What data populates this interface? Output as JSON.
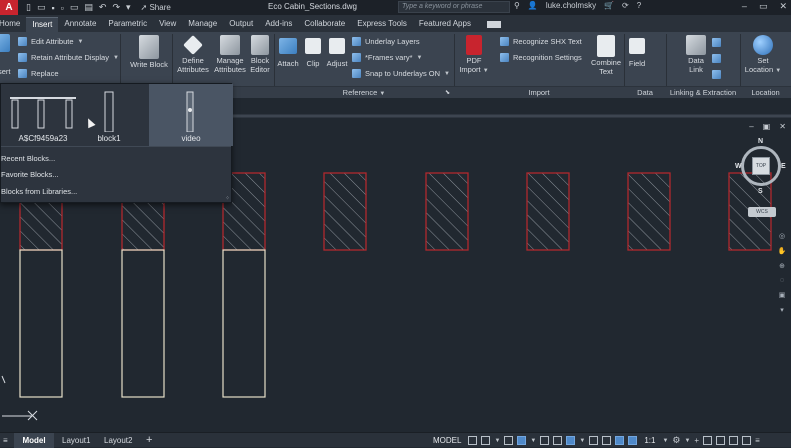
{
  "titlebar": {
    "logo": "A",
    "share_label": "Share",
    "document_title": "Eco Cabin_Sections.dwg",
    "search_placeholder": "Type a keyword or phrase",
    "user_name": "luke.cholmsky"
  },
  "tabs": [
    "Home",
    "Insert",
    "Annotate",
    "Parametric",
    "View",
    "Manage",
    "Output",
    "Add-ins",
    "Collaborate",
    "Express Tools",
    "Featured Apps"
  ],
  "active_tab": "Insert",
  "ribbon": {
    "block_panel": {
      "insert_label": "sert",
      "edit_attribute": "Edit Attribute",
      "retain_attribute_display": "Retain Attribute Display",
      "replace": "Replace"
    },
    "write_block": "Write Block",
    "define_attributes": [
      "Define",
      "Attributes"
    ],
    "manage_attributes": [
      "Manage",
      "Attributes"
    ],
    "block_editor": [
      "Block",
      "Editor"
    ],
    "attach": "Attach",
    "clip": "Clip",
    "adjust": "Adjust",
    "underlay_layers": "Underlay Layers",
    "frames_vary": "*Frames vary*",
    "snap_to_underlays": "Snap to Underlays ON",
    "reference_label": "Reference",
    "pdf_import": [
      "PDF",
      "Import"
    ],
    "recognize_shx": "Recognize SHX Text",
    "recognition_settings": "Recognition Settings",
    "combine_text": [
      "Combine",
      "Text"
    ],
    "import_label": "Import",
    "field": "Field",
    "data_label": "Data",
    "data_link": [
      "Data",
      "Link"
    ],
    "linking_label": "Linking & Extraction",
    "set_location": [
      "Set",
      "Location"
    ],
    "location_label": "Location"
  },
  "gallery": {
    "blocks": [
      "A$Cf9459a23",
      "block1",
      "video"
    ],
    "selected_block": "video",
    "menu": [
      "Recent Blocks...",
      "Favorite Blocks...",
      "Blocks from Libraries..."
    ]
  },
  "viewcube": {
    "face": "TOP",
    "n": "N",
    "w": "W",
    "e": "E",
    "s": "S",
    "wcs": "WCS"
  },
  "statusbar": {
    "layouts": [
      "Model",
      "Layout1",
      "Layout2"
    ],
    "active_layout": "Model",
    "add_layout": "+",
    "model_space": "MODEL",
    "scale": "1:1"
  },
  "colors": {
    "canvas": "#212830",
    "ribbon": "#3b4450",
    "hatch_outline": "#b1282e",
    "hatch_lines": "#8c939b",
    "column_outline": "#e6dfc8",
    "accent": "#4f89c9"
  }
}
